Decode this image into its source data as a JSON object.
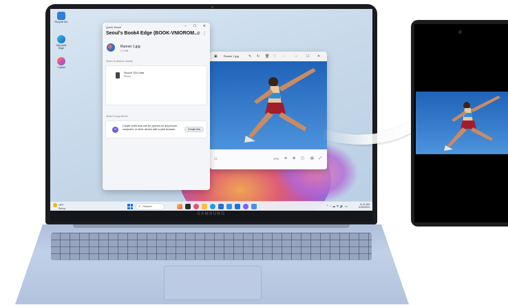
{
  "laptop": {
    "brand": "SAMSUNG"
  },
  "desktop_icons": [
    {
      "label": "Recycle Bin",
      "icon": "recycle-bin-icon",
      "color": "#2f7fd6"
    },
    {
      "label": "Microsoft Edge",
      "icon": "edge-icon",
      "color": "#1f9de0"
    },
    {
      "label": "Copilot",
      "icon": "copilot-icon",
      "color": "#d84ea9"
    }
  ],
  "quick_share": {
    "title": "Quick Share",
    "device_name": "Seoul's Book4 Edge (BOOK-VNIOROM...",
    "file": {
      "name": "Runner 1.jpg",
      "size": "1.2 MB"
    },
    "nearby_heading": "Share to devices nearby",
    "nearby_device": {
      "name": "Seoul's S24 Ultra",
      "type": "Phone"
    },
    "any_device_heading": "Share to any device",
    "link_text": "Create a link that can be opened on any phone, computer, or other device with a web browser.",
    "create_link_label": "Create link"
  },
  "photo_viewer": {
    "file_name": "Runner 1.jpg",
    "zoom": "17%"
  },
  "taskbar": {
    "weather_temp": "78°F",
    "weather_desc": "Sunny",
    "search_placeholder": "Search",
    "time": "11:11 AM",
    "date": "6/10/2024"
  },
  "colors": {
    "accent": "#1476e0",
    "sky": "#2a6fc2",
    "link_icon": "#6b5fd3"
  }
}
